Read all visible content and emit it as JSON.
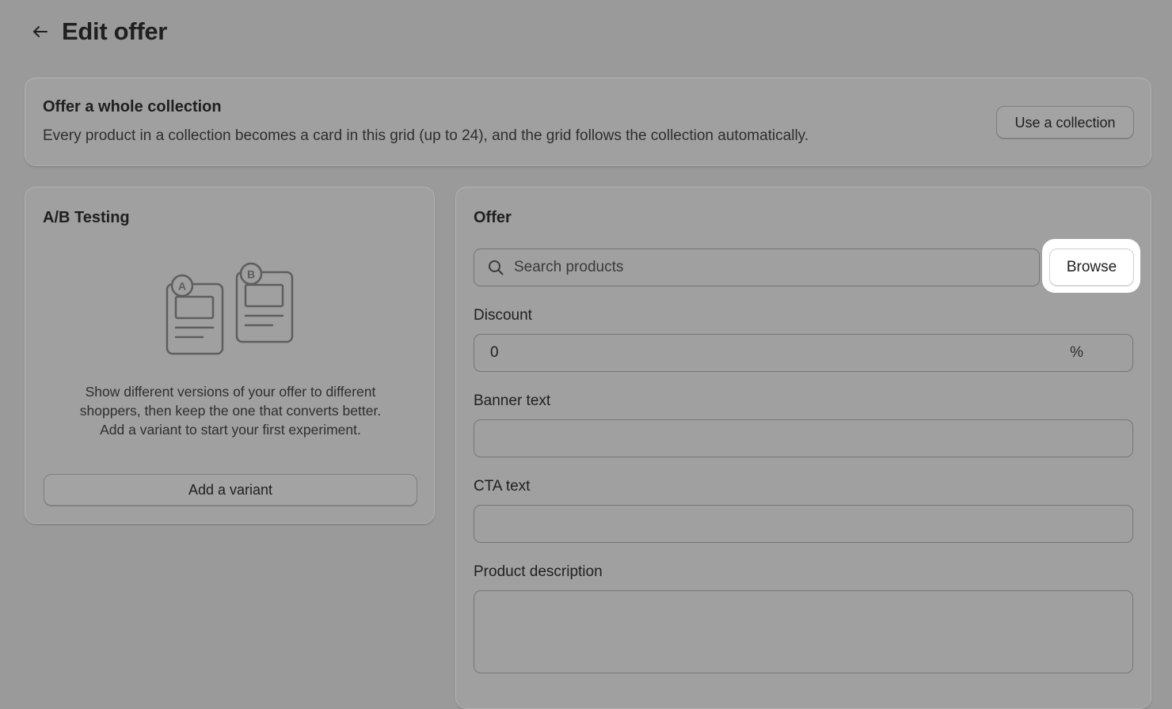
{
  "header": {
    "title": "Edit offer",
    "back_icon": "arrow-left-icon"
  },
  "collection_card": {
    "title": "Offer a whole collection",
    "description": "Every product in a collection becomes a card in this grid (up to 24), and the grid follows the collection automatically.",
    "button_label": "Use a collection"
  },
  "ab_card": {
    "title": "A/B Testing",
    "illustration_letters": [
      "A",
      "B"
    ],
    "description_lines": [
      "Show different versions of your offer to different",
      "shoppers, then keep the one that converts better.",
      "Add a variant to start your first experiment."
    ],
    "button_label": "Add a variant"
  },
  "offer_card": {
    "title": "Offer",
    "search": {
      "placeholder": "Search products",
      "value": "",
      "icon": "search-icon"
    },
    "browse_label": "Browse",
    "discount": {
      "label": "Discount",
      "value": "0",
      "suffix": "%"
    },
    "banner_text": {
      "label": "Banner text",
      "value": ""
    },
    "cta_text": {
      "label": "CTA text",
      "value": ""
    },
    "product_description": {
      "label": "Product description",
      "value": ""
    }
  },
  "colors": {
    "overlay_background": "#9a9a9a",
    "highlight": "#ffffff",
    "text": "#1f1f1f"
  }
}
